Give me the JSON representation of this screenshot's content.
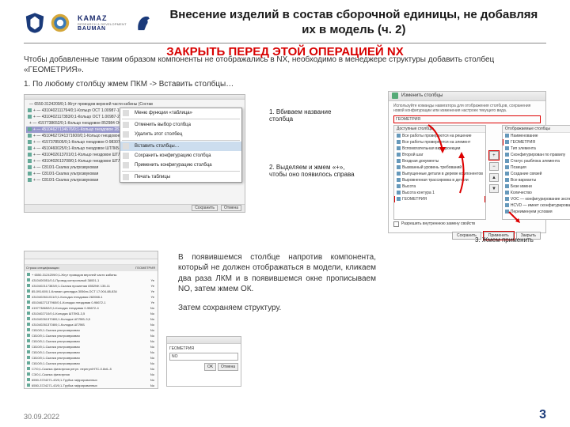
{
  "header": {
    "brand": {
      "line1": "KAMAZ",
      "line2": "RESEARCH & DEVELOPMENT",
      "line3": "BAUMAN"
    },
    "title": "Внесение изделий в состав сборочной единицы, не добавляя их в модель (ч. 2)"
  },
  "red_title": "ЗАКРЫТЬ ПЕРЕД ЭТОЙ ОПЕРАЦИЕЙ NX",
  "intro_line1": "Чтобы добавленные таким образом компоненты не отображались в NX, необходимо в менеджере структуры добавить столбец «ГЕОМЕТРИЯ».",
  "intro_line2": "1. По любому столбцу жмем ПКМ -> Вставить столбцы…",
  "shot1": {
    "tree_top": "— 6550-3124209/0;1-Жгут проводов верхней части кабины  (Состав)",
    "rows": [
      "+ — 4310402111794/0;1-Кольцо ОСТ 1.00987-1",
      "+ — 4310402117383/0;1-Кольцо ОСТ 1.00987-2",
      "+ — 4157738652/0;1-Кольцо гнездовое 852984 ОСТ 37.003.032-88–3",
      "+ — 45104627134676/0;1-Кольцо гнездовое 283088–1 (Состав)",
      "+ — 45104627241371600/0;1-Кольцо гнездовое 0-983073–1",
      "+ — 4157378505/0;1-Кольцо гнездовое 0-983073–1",
      "+ — 4510460025/0;1-Кольцо гнездовое ШТЛКБ-1",
      "+ — 4310402613701/0;1-Кольцо гнездовое ШТЛКБ-2",
      "+ — 4310402613708/0;1-Кольцо гнездовое ШТЛКБ-3",
      "+ — С810/1-Скалка ультрозвуковая",
      "+ — С810/1-Скалка ультрозвуковая",
      "+ — С810/1-Скалка ультрозвуковая"
    ],
    "selected_index": 3,
    "ctx": {
      "items": [
        "Меню функции «таблица»",
        "Отменить выбор столбца",
        "Удалить этот столбец",
        "Вставить столбцы…",
        "Сохранить конфигурацию столбца",
        "Применить конфигурацию столбца",
        "Печать таблицы"
      ],
      "highlight_index": 3
    },
    "footer_btns": [
      "Сохранить",
      "Отмена"
    ]
  },
  "shot2": {
    "title": "Изменить столбцы",
    "desc": "Используйте команды навигатора для отображения столбцов, сохранения новой конфигурации или изменения настроек текущего вида.",
    "left_header": "Доступные столбцы",
    "right_header": "Отображаемые столбцы",
    "input_value": "ГЕОМЕТРИЯ",
    "left_items": [
      "Все работы проверяются на решение",
      "Все работы проверяются на элемент",
      "Вспомогательная вид проекции",
      "Второй шаг",
      "Входная документы",
      "Вызванный уровень требований",
      "Выпущенные детали в дереве компонентов",
      "Выровненная трассировка в детали",
      "Высота",
      "Высота контура 1",
      "ГЕОМЕТРИЯ"
    ],
    "left_red_index": 10,
    "right_items": [
      "Наименование",
      "ГЕОМЕТРИЯ",
      "Тип элемента",
      "Сконфигурирован по правилу",
      "Статус разблока элемента",
      "Позиция",
      "Создание связей",
      "Все варианты",
      "Безе имени",
      "Количество",
      "VOC — конфигурирование экспертов после",
      "HCVD — имеет сконфигурированные данные",
      "Переименуем условия"
    ],
    "right_red_index": 1,
    "checkbox_label": "Разрешить внутреннюю замену свойств",
    "buttons": {
      "save": "Сохранить",
      "apply": "Применить",
      "close": "Закрыть"
    }
  },
  "ann": {
    "a1": "1. Вбиваем название столбца",
    "a2": "2. Выделяем и жмем «+», чтобы оно появилось справа",
    "a3": "3. Жмем применить"
  },
  "bodytext": {
    "p1": "В появившемся столбце напротив компонента, который не должен отображаться в модели, кликаем два раза ЛКМ и в появившемся окне прописываем NO, затем жмем ОК.",
    "p2": "Затем сохраняем структуру."
  },
  "shot3": {
    "cols": [
      "Строка спецификации",
      "ГЕОМЕТРИЯ"
    ],
    "rows": [
      {
        "t": "+ 6550-3124209/0;1-Жгут проводов верхней части кабины",
        "v": ""
      },
      {
        "t": "  4310400051/0;1-Провод контрольный 38001-1",
        "v": "Ye"
      },
      {
        "t": "  4310402117383/0;1-Скалка прокатная 6552NK 135-11",
        "v": "Ye"
      },
      {
        "t": "  85-09140/0;1-Клапан цилиндра 3056m-OCT 17.004-88-834",
        "v": "Ye"
      },
      {
        "t": "  4310402611011/0;1-Колодка гнездовая 282088-1",
        "v": "Ye"
      },
      {
        "t": "  45104627137960/0;1-Колодка гнездовая 0-98672-1",
        "v": "Ye"
      },
      {
        "t": "  4157738652/0;1-Колодка гнездовая 0-98672-4",
        "v": "No"
      },
      {
        "t": "  4310402710/0;1-Колодка ШТЛКБ-3,5",
        "v": "No"
      },
      {
        "t": "  4310402613708/0;1-Колодка ШТЛКБ-3,5",
        "v": "No"
      },
      {
        "t": "  4310402613708/0;1-Колодка ШТЛКБ",
        "v": "No"
      },
      {
        "t": "  С810/0;1-Скалка ультрозвуковая",
        "v": "No"
      },
      {
        "t": "  С810/0;1-Скалка ультрозвуковая",
        "v": "No"
      },
      {
        "t": "  С810/0;1-Скалка ультрозвуковая",
        "v": "No"
      },
      {
        "t": "  С810/0;1-Скалка ультрозвуковая",
        "v": "No"
      },
      {
        "t": "  С810/0;1-Скалка ультрозвуковая",
        "v": "No"
      },
      {
        "t": "  С810/0;1-Скалка ультрозвуковая",
        "v": "No"
      },
      {
        "t": "  С810/0;1-Скалка ультрозвуковая",
        "v": "No"
      },
      {
        "t": "  С7/0;1-Скалка фильтрная регул. нерегул/НТС-0.8x6–5",
        "v": "No"
      },
      {
        "t": "  С3/0;1-Скалка фильтрная",
        "v": "No"
      },
      {
        "t": "  6550-3724271-43/0;1-Трубка гафрированных",
        "v": "No"
      },
      {
        "t": "  6550-3724271-43/0;1-Трубка гафрированных",
        "v": "No"
      }
    ]
  },
  "shot4": {
    "label": "ГЕОМЕТРИЯ",
    "value": "NO",
    "ok": "OK",
    "cancel": "Отмена"
  },
  "footer_date": "30.09.2022",
  "page_num": "3"
}
